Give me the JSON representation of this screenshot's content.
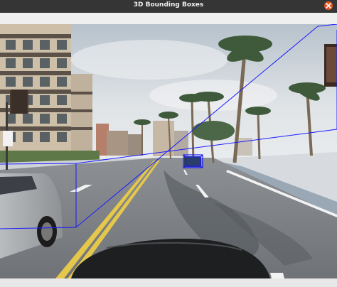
{
  "window": {
    "title": "3D Bounding Boxes",
    "close_icon": "close-icon",
    "close_color": "#e95420",
    "titlebar_color": "#353535"
  },
  "camera_view": {
    "scene": "urban street with palm trees and a leading car",
    "bbox_color": "#1a1aff",
    "detected_objects": [
      {
        "label": "vehicle",
        "box_color": "#1a1aff"
      }
    ]
  }
}
